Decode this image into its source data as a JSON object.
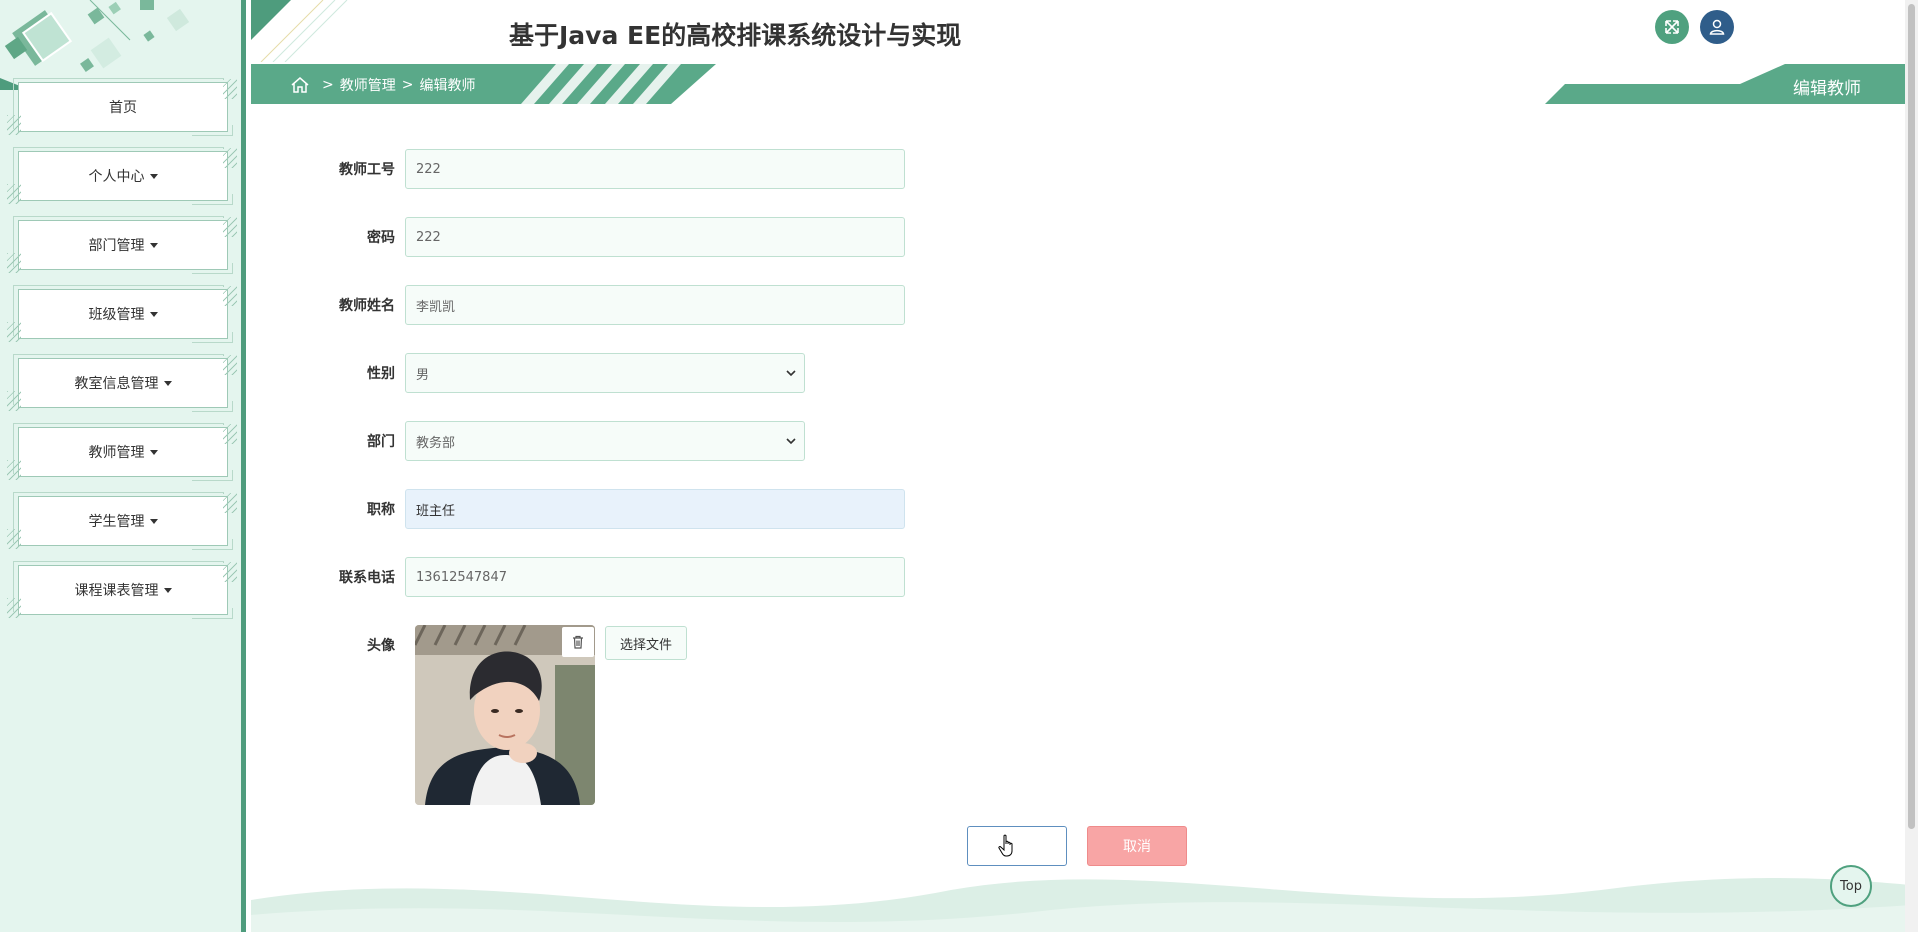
{
  "app": {
    "title": "基于Java EE的高校排课系统设计与实现",
    "accent_color": "#4fa17f",
    "sidebar_bg": "#e4f5ee"
  },
  "sidebar": {
    "items": [
      {
        "label": "首页",
        "dropdown": false
      },
      {
        "label": "个人中心",
        "dropdown": true
      },
      {
        "label": "部门管理",
        "dropdown": true
      },
      {
        "label": "班级管理",
        "dropdown": true
      },
      {
        "label": "教室信息管理",
        "dropdown": true
      },
      {
        "label": "教师管理",
        "dropdown": true
      },
      {
        "label": "学生管理",
        "dropdown": true
      },
      {
        "label": "课程课表管理",
        "dropdown": true
      }
    ]
  },
  "header": {
    "fullscreen_icon": "expand-arrows-icon",
    "user_icon": "user-icon"
  },
  "breadcrumb": {
    "home_icon": "home-icon",
    "separator": ">",
    "level1": "教师管理",
    "level2": "编辑教师"
  },
  "page_title": "编辑教师",
  "form": {
    "fields": {
      "teacher_id": {
        "label": "教师工号",
        "value": "222"
      },
      "password": {
        "label": "密码",
        "value": "222"
      },
      "teacher_name": {
        "label": "教师姓名",
        "value": "李凯凯"
      },
      "gender": {
        "label": "性别",
        "value": "男"
      },
      "department": {
        "label": "部门",
        "value": "教务部"
      },
      "job_title": {
        "label": "职称",
        "value": "班主任"
      },
      "phone": {
        "label": "联系电话",
        "value": "13612547847"
      },
      "avatar": {
        "label": "头像",
        "choose_file": "选择文件",
        "delete_icon": "trash-icon"
      }
    },
    "submit_label": "",
    "cancel_label": "取消"
  },
  "back_to_top": "Top"
}
